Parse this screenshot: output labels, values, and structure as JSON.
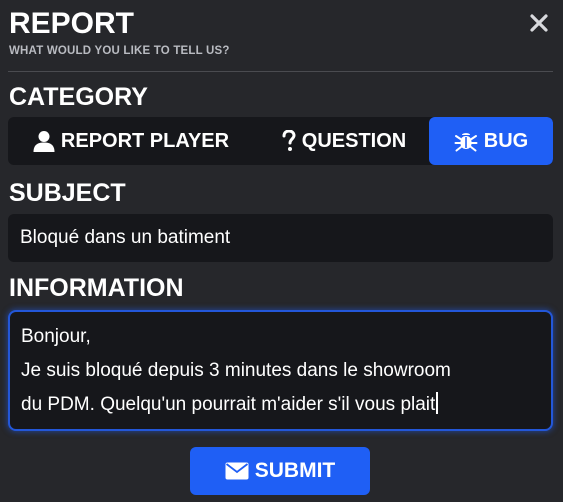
{
  "dialog": {
    "title": "REPORT",
    "subtitle": "WHAT WOULD YOU LIKE TO TELL US?",
    "close_icon": "close-icon"
  },
  "category": {
    "label": "CATEGORY",
    "options": [
      {
        "label": "REPORT PLAYER",
        "icon": "user-icon",
        "selected": false
      },
      {
        "label": "QUESTION",
        "icon": "question-icon",
        "selected": false
      },
      {
        "label": "BUG",
        "icon": "bug-icon",
        "selected": true
      }
    ]
  },
  "subject": {
    "label": "SUBJECT",
    "value": "Bloqué dans un batiment"
  },
  "information": {
    "label": "INFORMATION",
    "lines": [
      "Bonjour,",
      "Je suis bloqué depuis 3 minutes dans le showroom",
      "du PDM. Quelqu'un pourrait m'aider s'il vous plait"
    ]
  },
  "submit": {
    "label": "SUBMIT",
    "icon": "envelope-icon"
  },
  "colors": {
    "background": "#26272b",
    "field": "#16171b",
    "accent": "#1f5ff5"
  }
}
